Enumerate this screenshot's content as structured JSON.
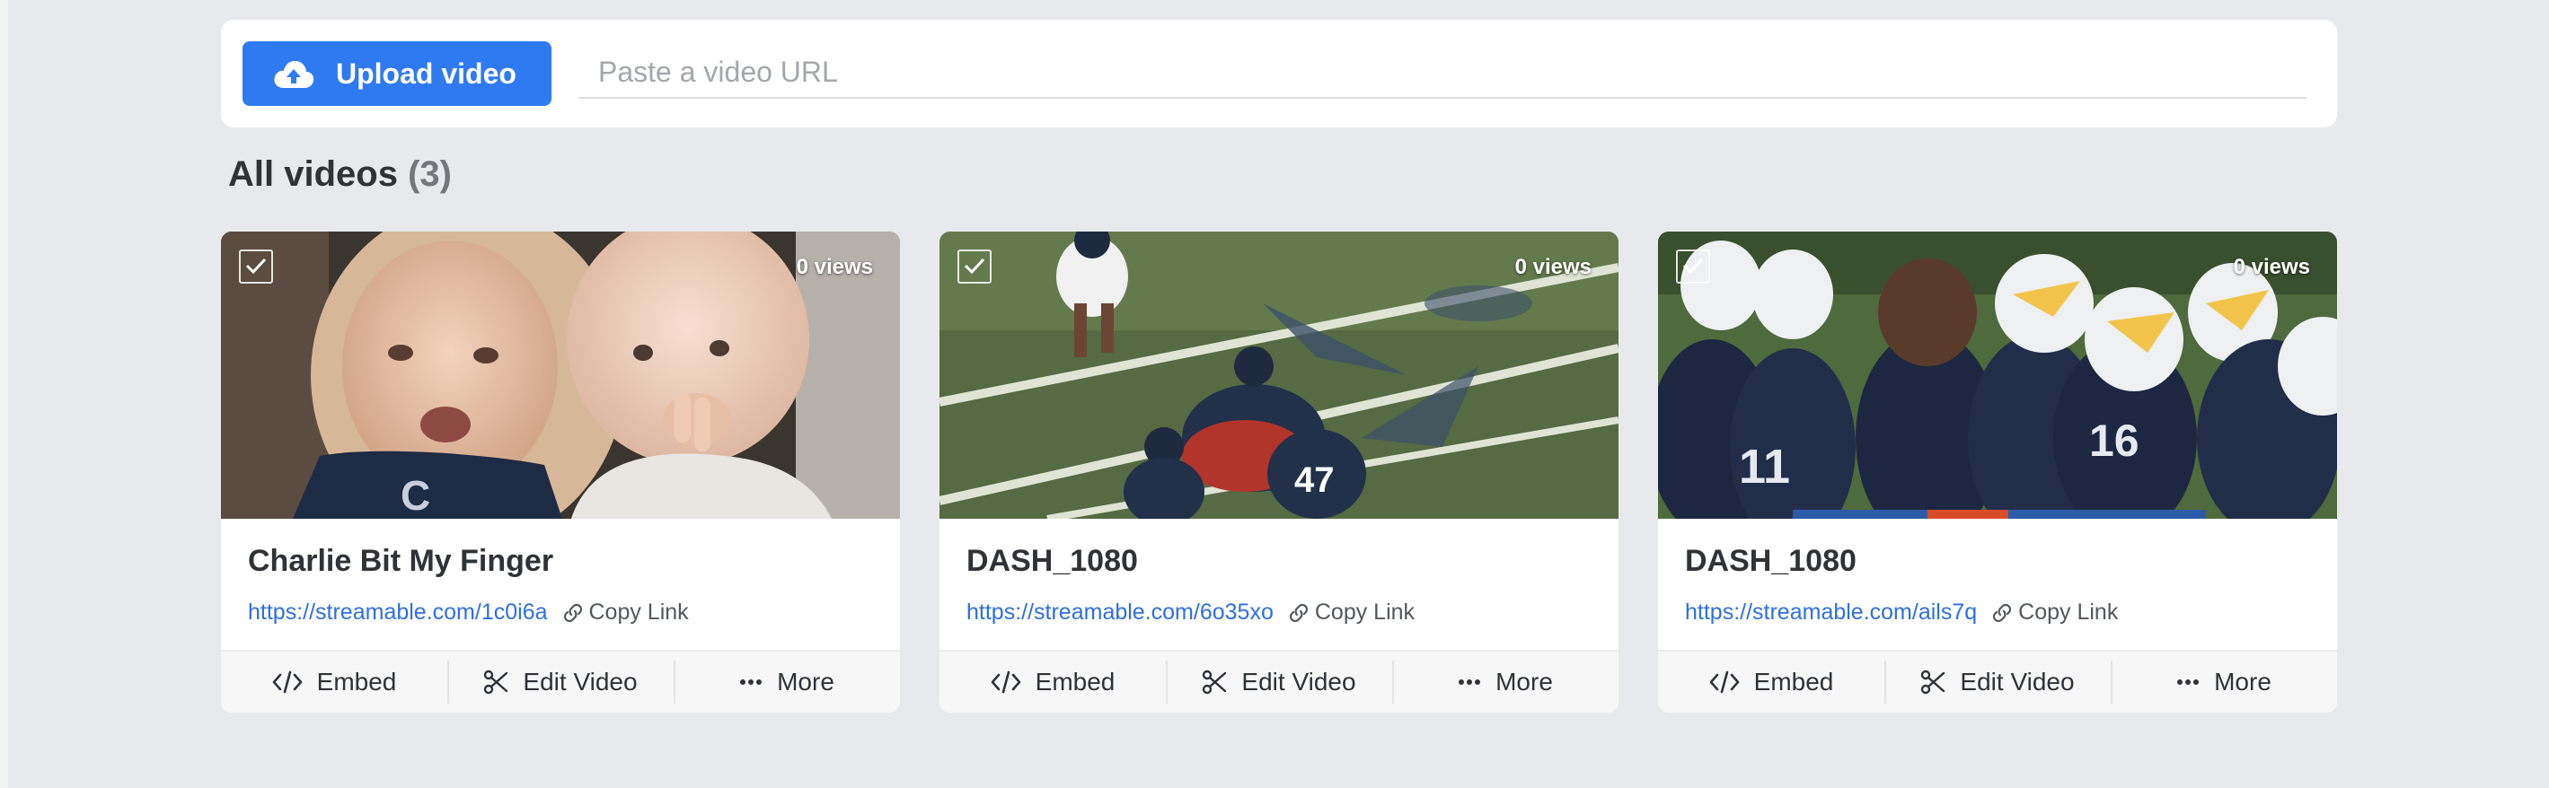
{
  "upload": {
    "button_label": "Upload video",
    "url_placeholder": "Paste a video URL"
  },
  "library": {
    "title": "All videos",
    "count": "(3)"
  },
  "videos": [
    {
      "title": "Charlie Bit My Finger",
      "url": "https://streamable.com/1c0i6a",
      "views": "0 views",
      "copy_label": "Copy Link",
      "selected": true,
      "thumbnail": "two-toddlers"
    },
    {
      "title": "DASH_1080",
      "url": "https://streamable.com/6o35xo",
      "views": "0 views",
      "copy_label": "Copy Link",
      "selected": true,
      "thumbnail": "football-tackle"
    },
    {
      "title": "DASH_1080",
      "url": "https://streamable.com/ails7q",
      "views": "0 views",
      "copy_label": "Copy Link",
      "selected": true,
      "thumbnail": "football-huddle"
    }
  ],
  "card_actions": {
    "embed": "Embed",
    "edit": "Edit Video",
    "more": "More"
  },
  "colors": {
    "accent": "#2f7af0",
    "link": "#2f6fdc",
    "background": "#e8e9ec"
  },
  "icons": [
    "cloud-upload-icon",
    "checkmark-icon",
    "link-icon",
    "code-icon",
    "scissors-icon",
    "ellipsis-icon"
  ]
}
